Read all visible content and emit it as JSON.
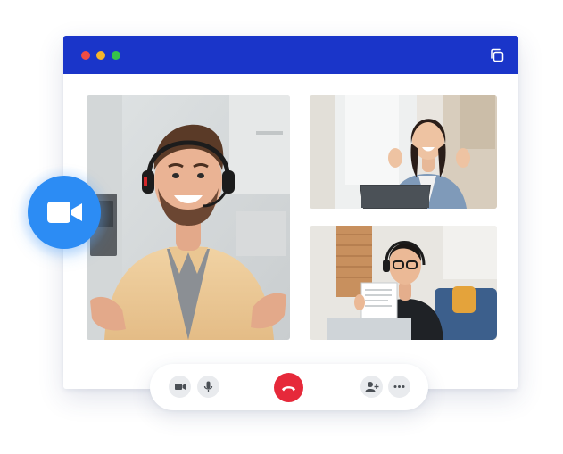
{
  "window": {
    "titlebar_color": "#1a35c9",
    "traffic_lights": [
      "#ef4d43",
      "#f6b52b",
      "#36c24a"
    ],
    "titlebar_icon": "copy-icon"
  },
  "participants": [
    {
      "role": "main-speaker",
      "description_icon": "video-tile",
      "headset": true
    },
    {
      "role": "participant",
      "description_icon": "video-tile",
      "waving": true
    },
    {
      "role": "participant",
      "description_icon": "video-tile",
      "headset": true
    }
  ],
  "floating_button": {
    "icon": "video-camera-icon",
    "color": "#2c8cf4"
  },
  "controls": {
    "video": {
      "icon": "video-camera-icon"
    },
    "mic": {
      "icon": "microphone-icon"
    },
    "end_call": {
      "icon": "phone-hangup-icon",
      "color": "#e6293a"
    },
    "add_participant": {
      "icon": "add-user-icon"
    },
    "more": {
      "icon": "more-options-icon"
    }
  }
}
